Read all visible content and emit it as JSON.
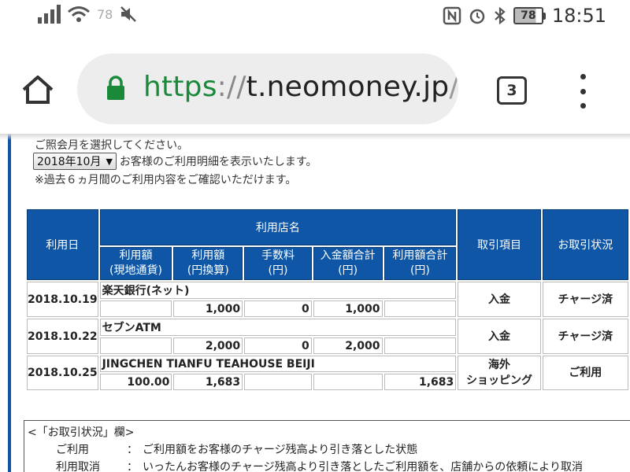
{
  "status_bar": {
    "signal_label": "R",
    "wifi_badge": "78",
    "battery": "78",
    "time": "18:51",
    "icons": [
      "signal-icon",
      "wifi-icon",
      "mute-icon",
      "nfc-icon",
      "alarm-icon",
      "bluetooth-icon",
      "battery-icon"
    ]
  },
  "browser": {
    "url_scheme": "https",
    "url_sep": "://",
    "url_host": "t.neomoney.jp",
    "url_rest": "/m",
    "tab_count": "3",
    "colors": {
      "secure": "#1a8a3a"
    }
  },
  "page": {
    "intro": "ご照会月を選択してください。",
    "month_selected": "2018年10月",
    "select_note": "お客様のご利用明細を表示いたします。",
    "history_note": "※過去６ヵ月間のご利用内容をご確認いただけます。",
    "colors": {
      "header": "#0f57a6"
    }
  },
  "table": {
    "headers": {
      "date": "利用日",
      "shop": "利用店名",
      "amount_local": "利用額\n(現地通貨)",
      "amount_yen": "利用額\n(円換算)",
      "fee": "手数料\n(円)",
      "deposit_total": "入金額合計\n(円)",
      "usage_total": "利用額合計\n(円)",
      "type": "取引項目",
      "status": "お取引状況"
    },
    "rows": [
      {
        "date": "2018.10.19",
        "shop": "楽天銀行(ネット)",
        "amount_local": "",
        "amount_yen": "1,000",
        "fee": "0",
        "deposit_total": "1,000",
        "usage_total": "",
        "type": "入金",
        "status": "チャージ済"
      },
      {
        "date": "2018.10.22",
        "shop": "セブンATM",
        "amount_local": "",
        "amount_yen": "2,000",
        "fee": "0",
        "deposit_total": "2,000",
        "usage_total": "",
        "type": "入金",
        "status": "チャージ済"
      },
      {
        "date": "2018.10.25",
        "shop": "JINGCHEN TIANFU TEAHOUSE BEIJI",
        "amount_local": "100.00",
        "amount_yen": "1,683",
        "fee": "",
        "deposit_total": "",
        "usage_total": "1,683",
        "type": "海外\nショッピング",
        "status": "ご利用"
      }
    ]
  },
  "legend": {
    "title": "<「お取引状況」欄>",
    "items": [
      {
        "term": "ご利用",
        "colon": "：",
        "desc": "ご利用額をお客様のチャージ残高より引き落とした状態"
      },
      {
        "term": "利用取消",
        "colon": "：",
        "desc": "いったんお客様のチャージ残高より引き落としたご利用額を、店舗からの依頼により取消"
      }
    ]
  }
}
